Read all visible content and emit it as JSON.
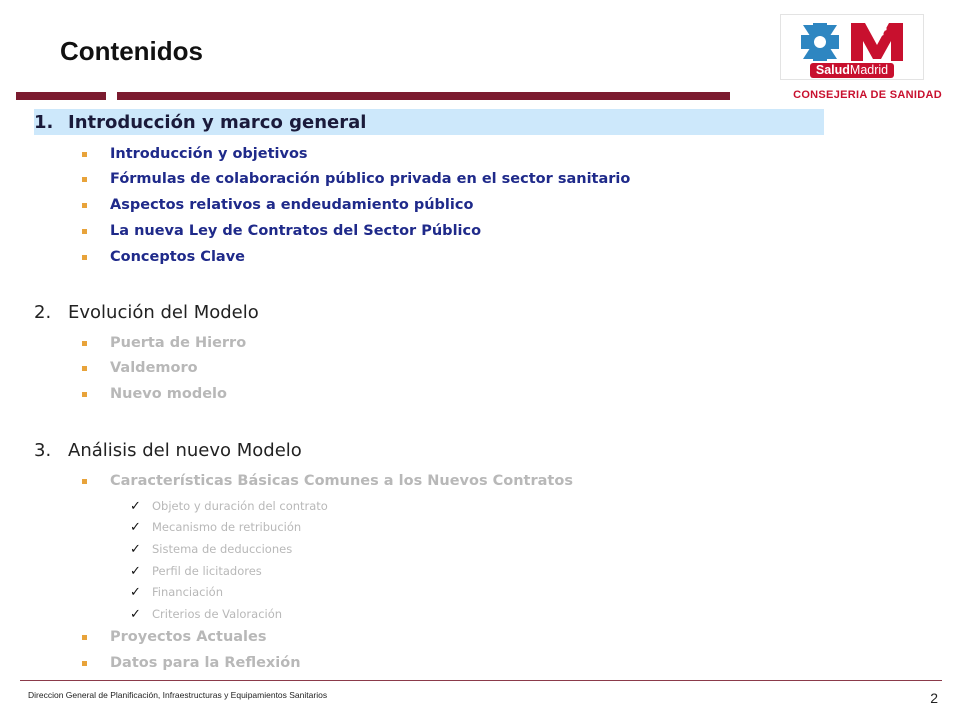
{
  "slide": {
    "title": "Contenidos",
    "organization": "CONSEJERIA DE SANIDAD",
    "logo": {
      "text_bold": "Salud",
      "text_regular": "Madrid",
      "icon": "salud-madrid-logo"
    },
    "colors": {
      "accent_bar": "#7b1b2f",
      "highlight": "#cde8fb",
      "bullet": "#e8a33a",
      "active_text": "#1f2a8a",
      "inactive_text": "#b8b8b8",
      "org_text": "#c8102e"
    }
  },
  "sections": [
    {
      "number": "1.",
      "title": "Introducción y marco general",
      "items": [
        "Introducción y objetivos",
        "Fórmulas de colaboración público privada en el sector sanitario",
        "Aspectos relativos a endeudamiento público",
        "La nueva Ley de Contratos del Sector Público",
        "Conceptos Clave"
      ]
    },
    {
      "number": "2.",
      "title": "Evolución del Modelo",
      "items": [
        "Puerta de Hierro",
        "Valdemoro",
        "Nuevo modelo"
      ]
    },
    {
      "number": "3.",
      "title": "Análisis del nuevo Modelo",
      "items": [
        "Características Básicas Comunes a los Nuevos Contratos",
        "Proyectos Actuales",
        "Datos para la Reflexión"
      ],
      "subitems": [
        "Objeto y duración del contrato",
        "Mecanismo de retribución",
        "Sistema de deducciones",
        "Perfil de licitadores",
        "Financiación",
        "Criterios de Valoración"
      ]
    }
  ],
  "footer": {
    "text": "Direccion General de Planificación, Infraestructuras y Equipamientos Sanitarios",
    "page": "2"
  }
}
